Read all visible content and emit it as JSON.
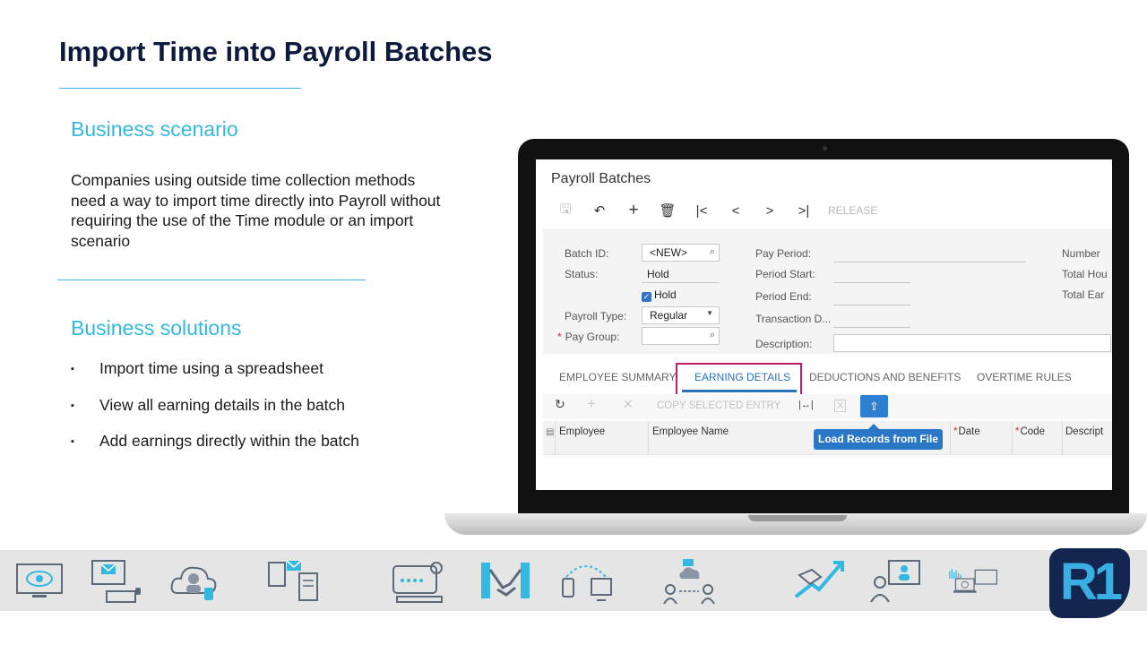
{
  "slide": {
    "title": "Import Time into Payroll Batches",
    "scenario_heading": "Business scenario",
    "scenario_text": "Companies using outside time collection methods need a way to import time directly into Payroll without requiring the use of the Time module or an import scenario",
    "solutions_heading": "Business solutions",
    "bullets": [
      "Import time using a spreadsheet",
      "View all earning details in the batch",
      "Add earnings directly within the batch"
    ],
    "bullet_glyph": "▪"
  },
  "screen": {
    "title": "Payroll Batches",
    "toolbar": {
      "save_icon": "🖫",
      "undo_icon": "↶",
      "add_icon": "+",
      "delete_icon": "🗑",
      "first_icon": "|<",
      "prev_icon": "<",
      "next_icon": ">",
      "last_icon": ">|",
      "release_label": "RELEASE"
    },
    "form": {
      "batch_id_label": "Batch ID:",
      "batch_id_value": "<NEW>",
      "status_label": "Status:",
      "status_value": "Hold",
      "hold_checkbox_label": "Hold",
      "hold_check_glyph": "✓",
      "payroll_type_label": "Payroll Type:",
      "payroll_type_value": "Regular",
      "pay_group_label": "Pay Group:",
      "required_mark": "*",
      "pay_period_label": "Pay Period:",
      "period_start_label": "Period Start:",
      "period_end_label": "Period End:",
      "transaction_date_label": "Transaction D...",
      "description_label": "Description:",
      "number_label": "Number",
      "total_hours_label": "Total Hou",
      "total_earnings_label": "Total Ear",
      "search_glyph": "⌕",
      "dropdown_glyph": "▼"
    },
    "tabs": [
      "EMPLOYEE SUMMARY",
      "EARNING DETAILS",
      "DEDUCTIONS AND BENEFITS",
      "OVERTIME RULES"
    ],
    "active_tab": "EARNING DETAILS",
    "grid_toolbar": {
      "refresh_glyph": "↻",
      "add_glyph": "+",
      "delete_glyph": "✕",
      "copy_label": "COPY SELECTED ENTRY",
      "fit_glyph": "|↔|",
      "excel_glyph": "X",
      "upload_glyph": "⇪",
      "tooltip": "Load Records from File"
    },
    "columns": [
      {
        "label": "Employee",
        "required": false
      },
      {
        "label": "Employee Name",
        "required": false
      },
      {
        "label": "Date",
        "required": true
      },
      {
        "label": "Code",
        "required": true
      },
      {
        "label": "Descript",
        "required": false
      }
    ],
    "row_icon_glyph": "▤"
  },
  "band_icons": [
    "monitor-eye-icon",
    "computer-mail-icon",
    "cloud-user-icon",
    "document-exchange-icon",
    "support-agent-icon",
    "handshake-icon",
    "device-network-icon",
    "cloud-collaboration-icon",
    "growth-handshake-icon",
    "video-conference-icon",
    "analytics-laptop-icon"
  ],
  "logo_text": "R1",
  "colors": {
    "title": "#0e1a3c",
    "heading_accent": "#33b8e0",
    "active_tab": "#2b73b9",
    "tab_highlight": "#c21a6b",
    "tooltip": "#2b77c7"
  }
}
